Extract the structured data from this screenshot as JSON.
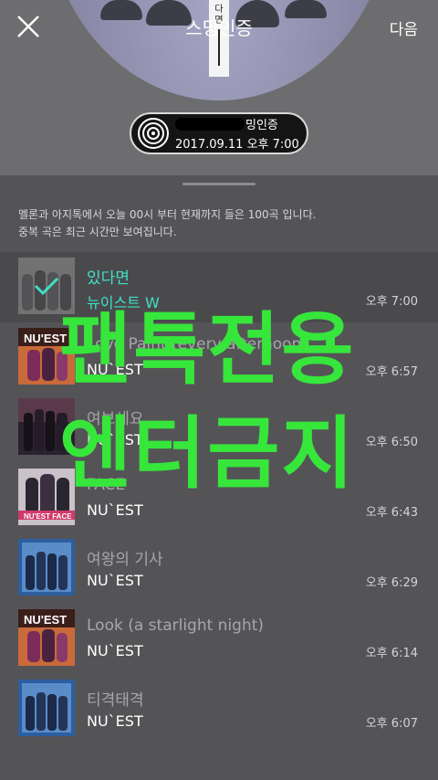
{
  "header": {
    "title": "스밍인증",
    "next_label": "다음",
    "strip_chars": [
      "다",
      "면"
    ]
  },
  "badge": {
    "line1": "밍인증",
    "line2": "2017.09.11 오후 7:00"
  },
  "info": {
    "line1": "멜론과 아지톡에서 오늘 00시 부터 현재까지 들은 100곡 입니다.",
    "line2": "중복 곡은 최근 시간만 보여집니다."
  },
  "songs": [
    {
      "title": "있다면",
      "artist": "뉴이스트 W",
      "time": "오후 7:00",
      "selected": true
    },
    {
      "title": "Love Paint (every afternoon)",
      "artist": "NU`EST",
      "time": "오후 6:57"
    },
    {
      "title": "여보세요",
      "artist": "NU`EST",
      "time": "오후 6:50"
    },
    {
      "title": "FACE",
      "artist": "NU`EST",
      "time": "오후 6:43"
    },
    {
      "title": "여왕의 기사",
      "artist": "NU`EST",
      "time": "오후 6:29"
    },
    {
      "title": "Look (a starlight night)",
      "artist": "NU`EST",
      "time": "오후 6:14"
    },
    {
      "title": "티격태격",
      "artist": "NU`EST",
      "time": "오후 6:07"
    }
  ],
  "watermark": {
    "line1": "팬톡전용",
    "line2": "엔터금지",
    "color": "#37e63b"
  },
  "colors": {
    "accent": "#3fe0c5"
  }
}
